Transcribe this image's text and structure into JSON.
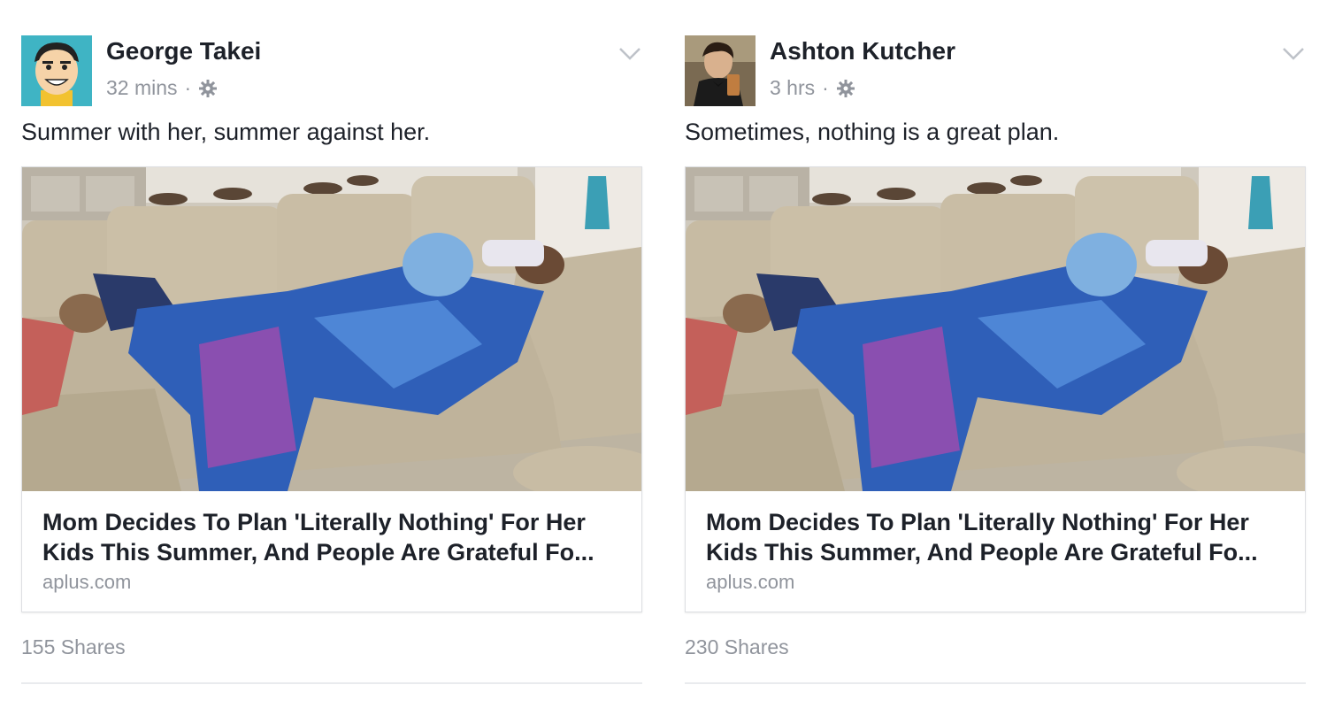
{
  "posts": [
    {
      "author": "George Takei",
      "time": "32 mins",
      "separator": "·",
      "privacy_icon": "gear-icon",
      "message": "Summer with her, summer against her.",
      "card": {
        "headline": "Mom Decides To Plan 'Literally Nothing' For Her Kids This Summer, And People Are Grateful Fo...",
        "domain": "aplus.com"
      },
      "shares": "155 Shares"
    },
    {
      "author": "Ashton Kutcher",
      "time": "3 hrs",
      "separator": "·",
      "privacy_icon": "gear-icon",
      "message": "Sometimes, nothing is a great plan.",
      "card": {
        "headline": "Mom Decides To Plan 'Literally Nothing' For Her Kids This Summer, And People Are Grateful Fo...",
        "domain": "aplus.com"
      },
      "shares": "230 Shares"
    }
  ],
  "colors": {
    "name_text": "#1d2129",
    "meta_text": "#90949c",
    "divider": "#e9ebee",
    "card_border": "#dddfe2"
  }
}
